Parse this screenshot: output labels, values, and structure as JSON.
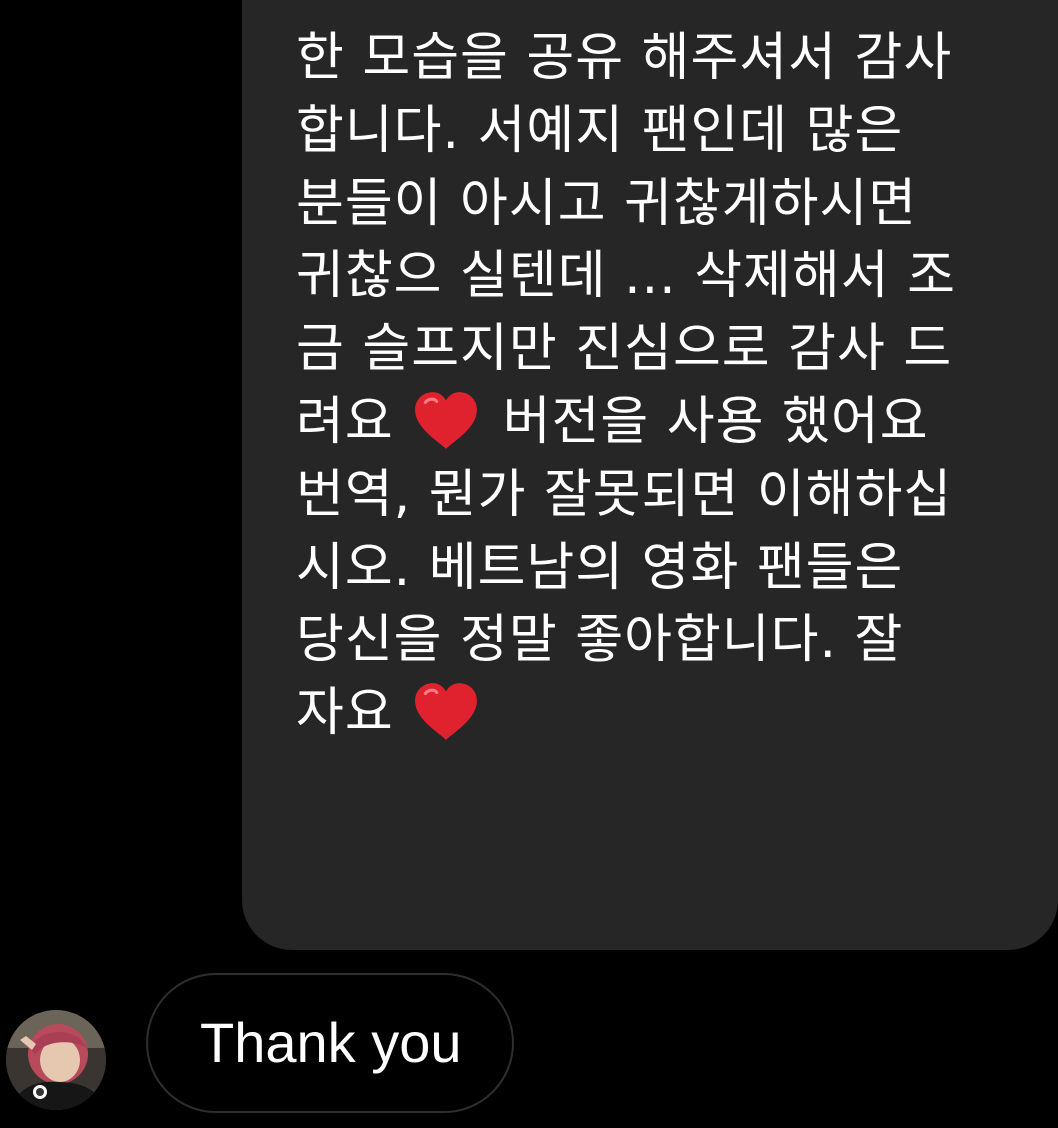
{
  "conversation": {
    "sent_message": {
      "lines": [
        "한 모습을 공유 해주셔서 감사",
        "합니다.  서예지 팬인데 많은",
        "분들이 아시고 귀찮게하시면",
        "귀찮으 실텐데 ... 삭제해서 조",
        "금 슬프지만 진심으로 감사 드",
        "려요",
        "버전을 사용 했어요",
        "번역, 뭔가 잘못되면 이해하십",
        "시오.  베트남의 영화 팬들은",
        "당신을 정말 좋아합니다.  잘",
        "자요"
      ],
      "emoji": "heart-emoji",
      "bubble_color": "#262626"
    },
    "received_message": {
      "text": "Thank you",
      "border_color": "#2e2e2e"
    },
    "sender_avatar": "avatar"
  }
}
